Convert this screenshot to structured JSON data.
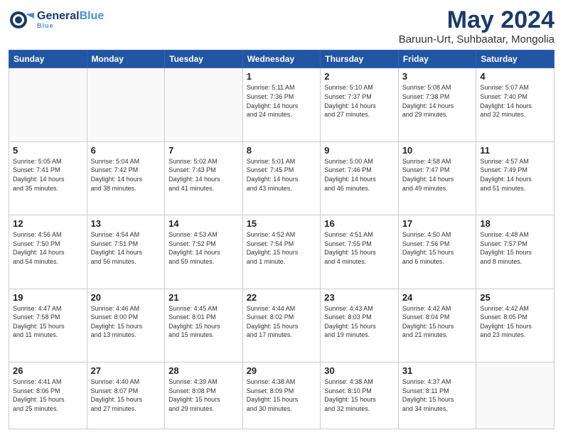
{
  "header": {
    "logo_general": "General",
    "logo_blue": "Blue",
    "logo_sub": "Blue",
    "month": "May 2024",
    "location": "Baruun-Urt, Suhbaatar, Mongolia"
  },
  "days_of_week": [
    "Sunday",
    "Monday",
    "Tuesday",
    "Wednesday",
    "Thursday",
    "Friday",
    "Saturday"
  ],
  "weeks": [
    [
      {
        "day": "",
        "text": ""
      },
      {
        "day": "",
        "text": ""
      },
      {
        "day": "",
        "text": ""
      },
      {
        "day": "1",
        "text": "Sunrise: 5:11 AM\nSunset: 7:36 PM\nDaylight: 14 hours\nand 24 minutes."
      },
      {
        "day": "2",
        "text": "Sunrise: 5:10 AM\nSunset: 7:37 PM\nDaylight: 14 hours\nand 27 minutes."
      },
      {
        "day": "3",
        "text": "Sunrise: 5:08 AM\nSunset: 7:38 PM\nDaylight: 14 hours\nand 29 minutes."
      },
      {
        "day": "4",
        "text": "Sunrise: 5:07 AM\nSunset: 7:40 PM\nDaylight: 14 hours\nand 32 minutes."
      }
    ],
    [
      {
        "day": "5",
        "text": "Sunrise: 5:05 AM\nSunset: 7:41 PM\nDaylight: 14 hours\nand 35 minutes."
      },
      {
        "day": "6",
        "text": "Sunrise: 5:04 AM\nSunset: 7:42 PM\nDaylight: 14 hours\nand 38 minutes."
      },
      {
        "day": "7",
        "text": "Sunrise: 5:02 AM\nSunset: 7:43 PM\nDaylight: 14 hours\nand 41 minutes."
      },
      {
        "day": "8",
        "text": "Sunrise: 5:01 AM\nSunset: 7:45 PM\nDaylight: 14 hours\nand 43 minutes."
      },
      {
        "day": "9",
        "text": "Sunrise: 5:00 AM\nSunset: 7:46 PM\nDaylight: 14 hours\nand 46 minutes."
      },
      {
        "day": "10",
        "text": "Sunrise: 4:58 AM\nSunset: 7:47 PM\nDaylight: 14 hours\nand 49 minutes."
      },
      {
        "day": "11",
        "text": "Sunrise: 4:57 AM\nSunset: 7:49 PM\nDaylight: 14 hours\nand 51 minutes."
      }
    ],
    [
      {
        "day": "12",
        "text": "Sunrise: 4:56 AM\nSunset: 7:50 PM\nDaylight: 14 hours\nand 54 minutes."
      },
      {
        "day": "13",
        "text": "Sunrise: 4:54 AM\nSunset: 7:51 PM\nDaylight: 14 hours\nand 56 minutes."
      },
      {
        "day": "14",
        "text": "Sunrise: 4:53 AM\nSunset: 7:52 PM\nDaylight: 14 hours\nand 59 minutes."
      },
      {
        "day": "15",
        "text": "Sunrise: 4:52 AM\nSunset: 7:54 PM\nDaylight: 15 hours\nand 1 minute."
      },
      {
        "day": "16",
        "text": "Sunrise: 4:51 AM\nSunset: 7:55 PM\nDaylight: 15 hours\nand 4 minutes."
      },
      {
        "day": "17",
        "text": "Sunrise: 4:50 AM\nSunset: 7:56 PM\nDaylight: 15 hours\nand 6 minutes."
      },
      {
        "day": "18",
        "text": "Sunrise: 4:48 AM\nSunset: 7:57 PM\nDaylight: 15 hours\nand 8 minutes."
      }
    ],
    [
      {
        "day": "19",
        "text": "Sunrise: 4:47 AM\nSunset: 7:58 PM\nDaylight: 15 hours\nand 11 minutes."
      },
      {
        "day": "20",
        "text": "Sunrise: 4:46 AM\nSunset: 8:00 PM\nDaylight: 15 hours\nand 13 minutes."
      },
      {
        "day": "21",
        "text": "Sunrise: 4:45 AM\nSunset: 8:01 PM\nDaylight: 15 hours\nand 15 minutes."
      },
      {
        "day": "22",
        "text": "Sunrise: 4:44 AM\nSunset: 8:02 PM\nDaylight: 15 hours\nand 17 minutes."
      },
      {
        "day": "23",
        "text": "Sunrise: 4:43 AM\nSunset: 8:03 PM\nDaylight: 15 hours\nand 19 minutes."
      },
      {
        "day": "24",
        "text": "Sunrise: 4:42 AM\nSunset: 8:04 PM\nDaylight: 15 hours\nand 21 minutes."
      },
      {
        "day": "25",
        "text": "Sunrise: 4:42 AM\nSunset: 8:05 PM\nDaylight: 15 hours\nand 23 minutes."
      }
    ],
    [
      {
        "day": "26",
        "text": "Sunrise: 4:41 AM\nSunset: 8:06 PM\nDaylight: 15 hours\nand 25 minutes."
      },
      {
        "day": "27",
        "text": "Sunrise: 4:40 AM\nSunset: 8:07 PM\nDaylight: 15 hours\nand 27 minutes."
      },
      {
        "day": "28",
        "text": "Sunrise: 4:39 AM\nSunset: 8:08 PM\nDaylight: 15 hours\nand 29 minutes."
      },
      {
        "day": "29",
        "text": "Sunrise: 4:38 AM\nSunset: 8:09 PM\nDaylight: 15 hours\nand 30 minutes."
      },
      {
        "day": "30",
        "text": "Sunrise: 4:38 AM\nSunset: 8:10 PM\nDaylight: 15 hours\nand 32 minutes."
      },
      {
        "day": "31",
        "text": "Sunrise: 4:37 AM\nSunset: 8:11 PM\nDaylight: 15 hours\nand 34 minutes."
      },
      {
        "day": "",
        "text": ""
      }
    ]
  ]
}
